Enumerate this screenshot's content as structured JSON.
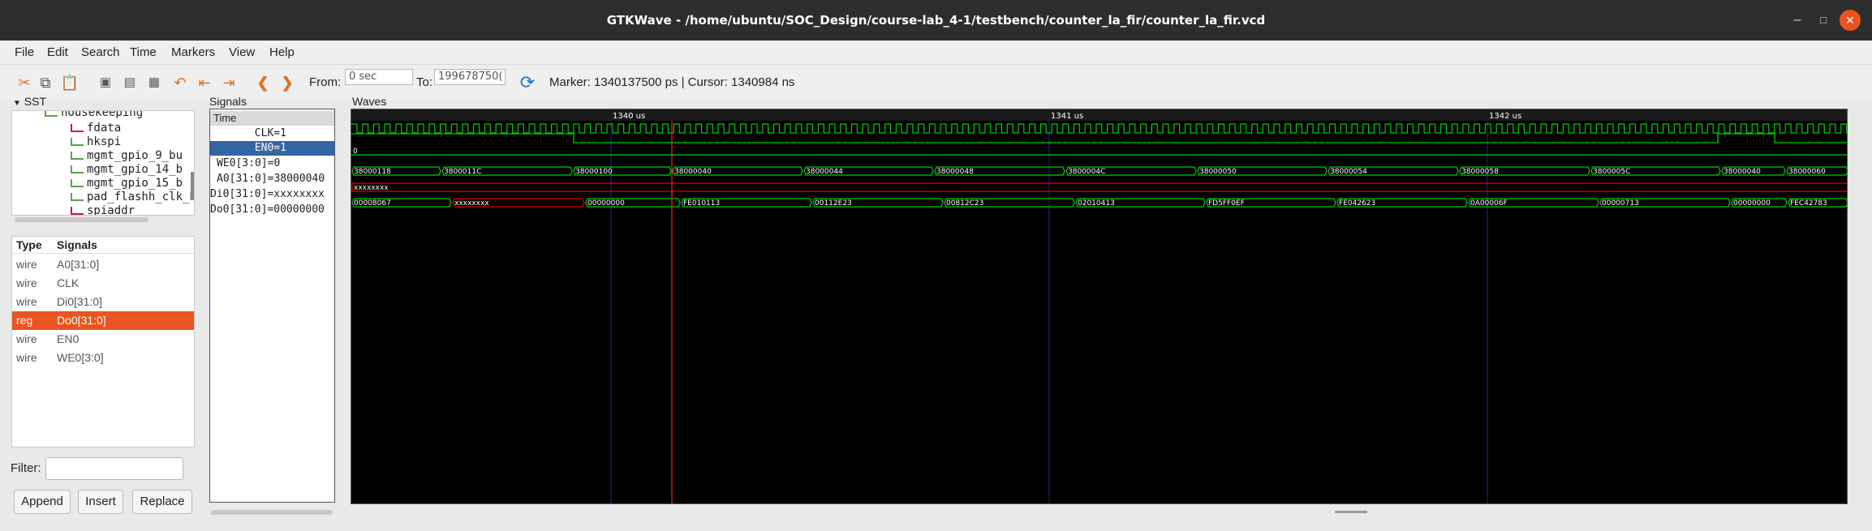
{
  "window": {
    "title": "GTKWave - /home/ubuntu/SOC_Design/course-lab_4-1/testbench/counter_la_fir/counter_la_fir.vcd"
  },
  "menu": [
    "File",
    "Edit",
    "Search",
    "Time",
    "Markers",
    "View",
    "Help"
  ],
  "toolbar": {
    "from_label": "From:",
    "from_value": "0 sec",
    "to_label": "To:",
    "to_value": "199678750(",
    "marker_text": "Marker: 1340137500 ps  |  Cursor: 1340984 ns"
  },
  "sst": {
    "label": "SST",
    "tree": [
      "housekeeping",
      "fdata",
      "hkspi",
      "mgmt_gpio_9_bu",
      "mgmt_gpio_14_b",
      "mgmt_gpio_15_b",
      "pad_flashh_clk_b",
      "spiaddr"
    ]
  },
  "type_signals": {
    "header_type": "Type",
    "header_signals": "Signals",
    "rows": [
      {
        "type": "wire",
        "name": "A0[31:0]"
      },
      {
        "type": "wire",
        "name": "CLK"
      },
      {
        "type": "wire",
        "name": "Di0[31:0]"
      },
      {
        "type": "reg",
        "name": "Do0[31:0]"
      },
      {
        "type": "wire",
        "name": "EN0"
      },
      {
        "type": "wire",
        "name": "WE0[3:0]"
      }
    ]
  },
  "filter_label": "Filter:",
  "buttons": {
    "append": "Append",
    "insert": "Insert",
    "replace": "Replace"
  },
  "signals_panel": {
    "label": "Signals",
    "time_label": "Time",
    "rows": [
      "       CLK=1",
      "       EN0=1",
      "WE0[3:0]=0",
      "A0[31:0]=38000040",
      "Di0[31:0]=xxxxxxxx",
      "Do0[31:0]=00000000"
    ]
  },
  "waves": {
    "label": "Waves",
    "time_markers": [
      "1340 us",
      "1341 us",
      "1342 us"
    ],
    "we0_value": "0",
    "di0_value": "xxxxxxxx",
    "a0_values": [
      "38000118",
      "3800011C",
      "38000100",
      "38000040",
      "38000044",
      "38000048",
      "3800004C",
      "38000050",
      "38000054",
      "38000058",
      "3800005C",
      "38000040",
      "38000060"
    ],
    "do0_values": [
      "00008067",
      "xxxxxxxx",
      "00000000",
      "FE010113",
      "00112E23",
      "00812C23",
      "02010413",
      "FD5FF0EF",
      "FE042623",
      "0A00006F",
      "00000713",
      "00000000",
      "FEC42783"
    ]
  },
  "colors": {
    "title_bg": "#2d2d2d",
    "accent": "#e95420",
    "selection": "#3465a4",
    "wave_green": "#00d000",
    "wave_red": "#e00000"
  }
}
